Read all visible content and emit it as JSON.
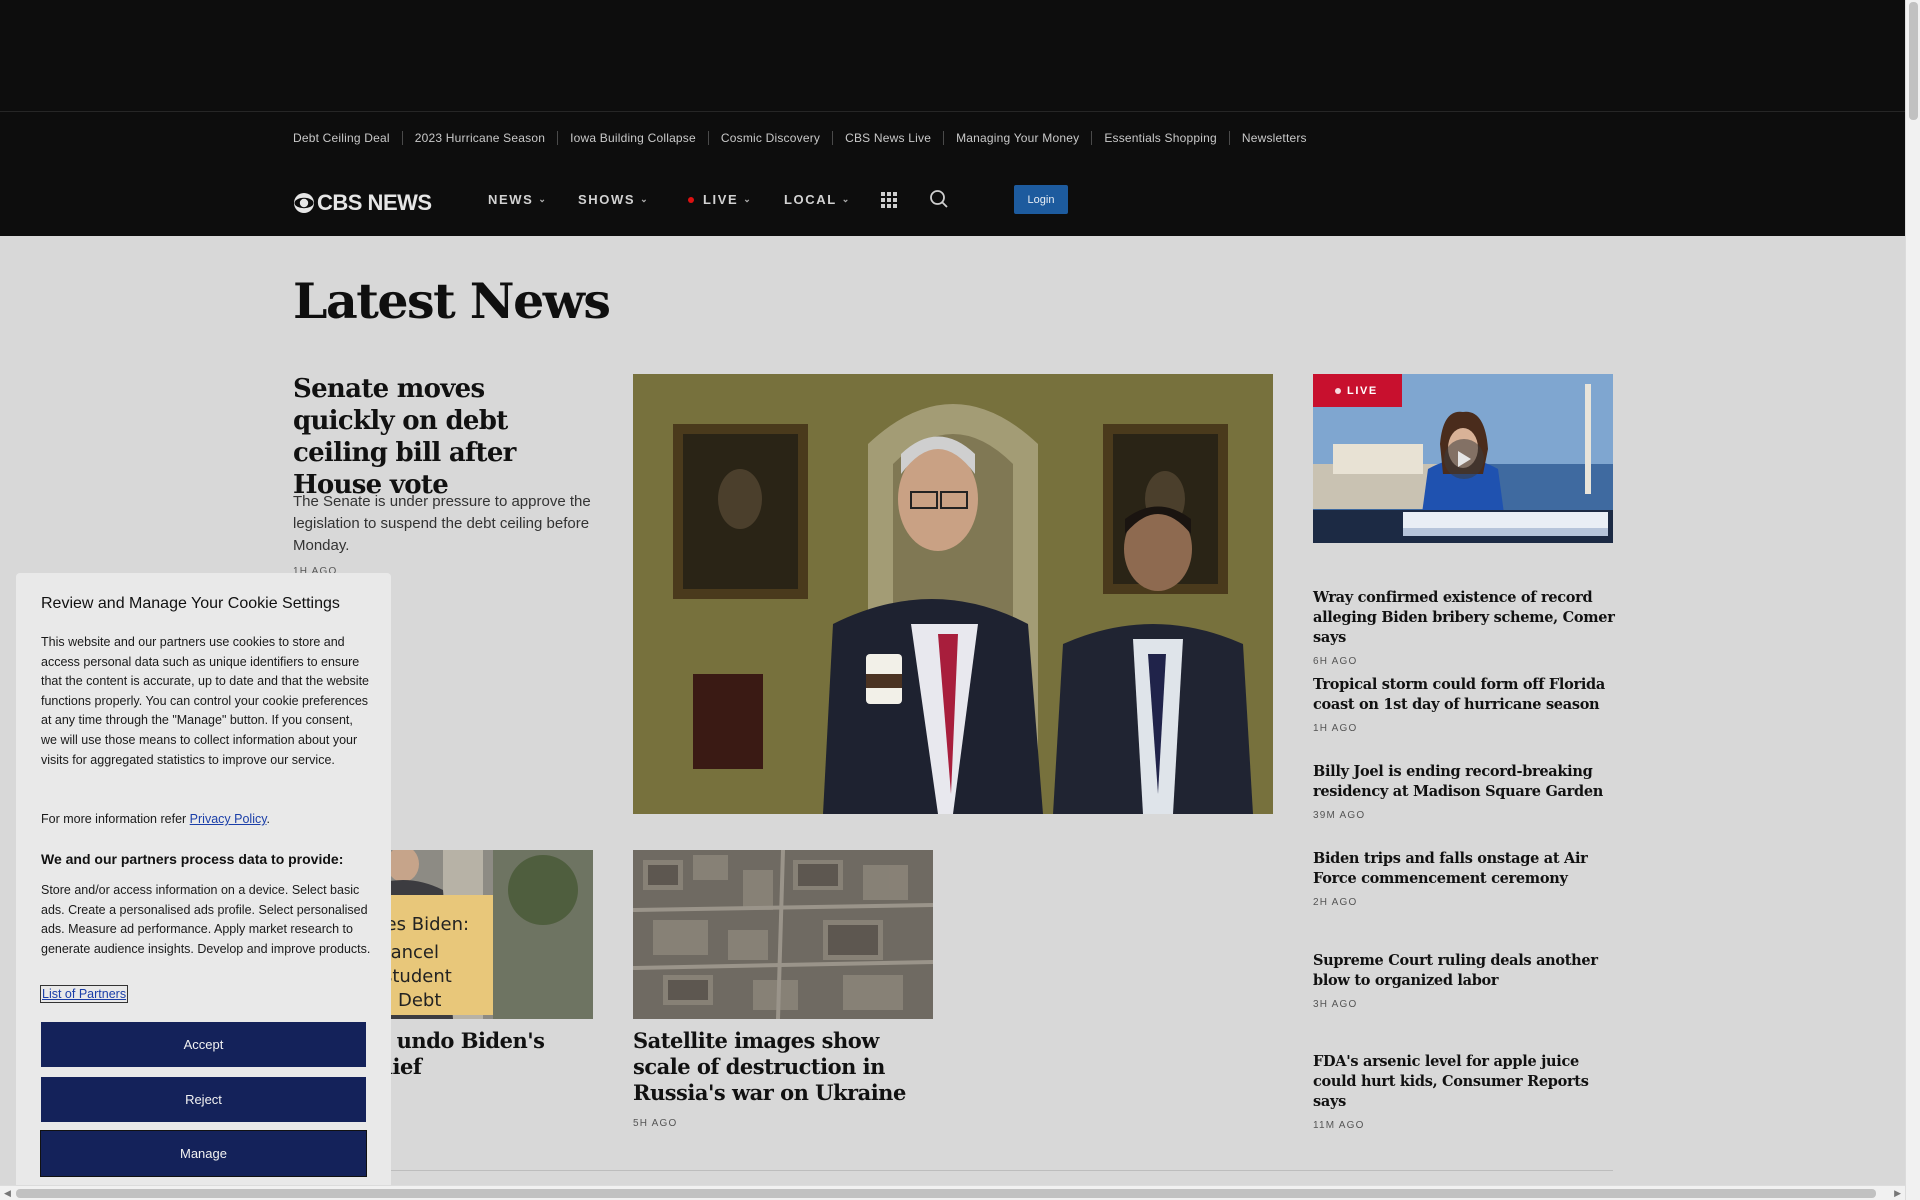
{
  "trending": [
    "Debt Ceiling Deal",
    "2023 Hurricane Season",
    "Iowa Building Collapse",
    "Cosmic Discovery",
    "CBS News Live",
    "Managing Your Money",
    "Essentials Shopping",
    "Newsletters"
  ],
  "nav": {
    "logo": "CBS NEWS",
    "news": "NEWS",
    "shows": "SHOWS",
    "live": "LIVE",
    "local": "LOCAL",
    "login": "Login"
  },
  "page_title": "Latest News",
  "lead": {
    "headline": "Senate moves quickly on debt ceiling bill after House vote",
    "summary": "The Senate is under pressure to approve the legislation to suspend the debt ceiling before Monday.",
    "time": "1H AGO"
  },
  "cards": [
    {
      "headline": "...otes to undo Biden's ...oan relief",
      "time": "",
      "sign_text": "Pres Biden: Cancel Student Debt"
    },
    {
      "headline": "Satellite images show scale of destruction in Russia's war on Ukraine",
      "time": "5H AGO"
    }
  ],
  "live_video": {
    "badge": "LIVE"
  },
  "side_items": [
    {
      "headline": "Wray confirmed existence of record alleging Biden bribery scheme, Comer says",
      "time": "6H AGO"
    },
    {
      "headline": "Tropical storm could form off Florida coast on 1st day of hurricane season",
      "time": "1H AGO"
    },
    {
      "headline": "Billy Joel is ending record-breaking residency at Madison Square Garden",
      "time": "39M AGO"
    },
    {
      "headline": "Biden trips and falls onstage at Air Force commencement ceremony",
      "time": "2H AGO"
    },
    {
      "headline": "Supreme Court ruling deals another blow to organized labor",
      "time": "3H AGO"
    },
    {
      "headline": "FDA's arsenic level for apple juice could hurt kids, Consumer Reports says",
      "time": "11M AGO"
    }
  ],
  "cookie": {
    "title": "Review and Manage Your Cookie Settings",
    "body": "This website and our partners use cookies to store and access personal data such as unique identifiers to ensure that the content is accurate, up to date and that the website functions properly. You can control your cookie preferences at any time through the \"Manage\" button. If you consent, we will use those means to collect information about your visits for aggregated statistics to improve our service.",
    "more_info_prefix": "For more information refer ",
    "privacy_link": "Privacy Policy",
    "more_info_suffix": ".",
    "purposes_title": "We and our partners process data to provide:",
    "purposes": "Store and/or access information on a device. Select basic ads. Create a personalised ads profile. Select personalised ads. Measure ad performance. Apply market research to generate audience insights. Develop and improve products.",
    "partners_link": "List of Partners",
    "accept": "Accept",
    "reject": "Reject",
    "manage": "Manage"
  },
  "colors": {
    "background": "#d8d8d8",
    "header": "#0d0d0d",
    "login": "#1d5b9e",
    "live": "#c8102e",
    "cookie_button": "#14225a"
  }
}
